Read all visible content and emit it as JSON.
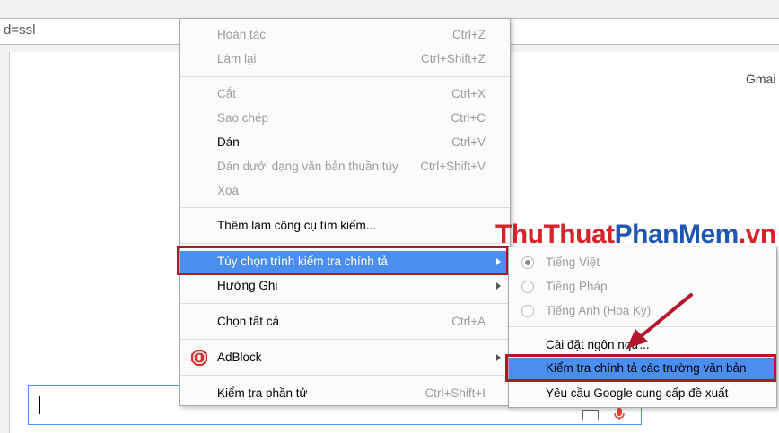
{
  "browser": {
    "url_fragment": "d=ssl"
  },
  "page": {
    "gmail_link": "Gmai"
  },
  "context_menu": {
    "items": [
      {
        "label": "Hoàn tác",
        "shortcut": "Ctrl+Z"
      },
      {
        "label": "Làm lại",
        "shortcut": "Ctrl+Shift+Z"
      },
      {
        "label": "Cắt",
        "shortcut": "Ctrl+X"
      },
      {
        "label": "Sao chép",
        "shortcut": "Ctrl+C"
      },
      {
        "label": "Dán",
        "shortcut": "Ctrl+V"
      },
      {
        "label": "Dán dưới dạng văn bản thuần túy",
        "shortcut": "Ctrl+Shift+V"
      },
      {
        "label": "Xoá",
        "shortcut": ""
      },
      {
        "label": "Thêm làm công cụ tìm kiếm...",
        "shortcut": ""
      },
      {
        "label": "Tùy chọn trình kiểm tra chính tả",
        "shortcut": ""
      },
      {
        "label": "Hướng Ghi",
        "shortcut": ""
      },
      {
        "label": "Chọn tất cả",
        "shortcut": "Ctrl+A"
      },
      {
        "label": "AdBlock",
        "shortcut": ""
      },
      {
        "label": "Kiểm tra phần tử",
        "shortcut": "Ctrl+Shift+I"
      }
    ]
  },
  "submenu": {
    "items": [
      {
        "label": "Tiếng Việt"
      },
      {
        "label": "Tiếng Pháp"
      },
      {
        "label": "Tiếng Anh (Hoa Kỳ)"
      },
      {
        "label": "Cài đặt ngôn ngữ..."
      },
      {
        "label": "Kiểm tra chính tả các trường văn bản"
      },
      {
        "label": "Yêu cầu Google cung cấp đề xuất"
      }
    ]
  },
  "watermark": {
    "part1": "ThuThuat",
    "part2": "PhanMem",
    "part3": ".vn"
  },
  "colors": {
    "highlight": "#4a8ff0",
    "annotation_red": "#b3162b",
    "watermark_red": "#d8232a",
    "watermark_blue": "#1e56b3"
  }
}
